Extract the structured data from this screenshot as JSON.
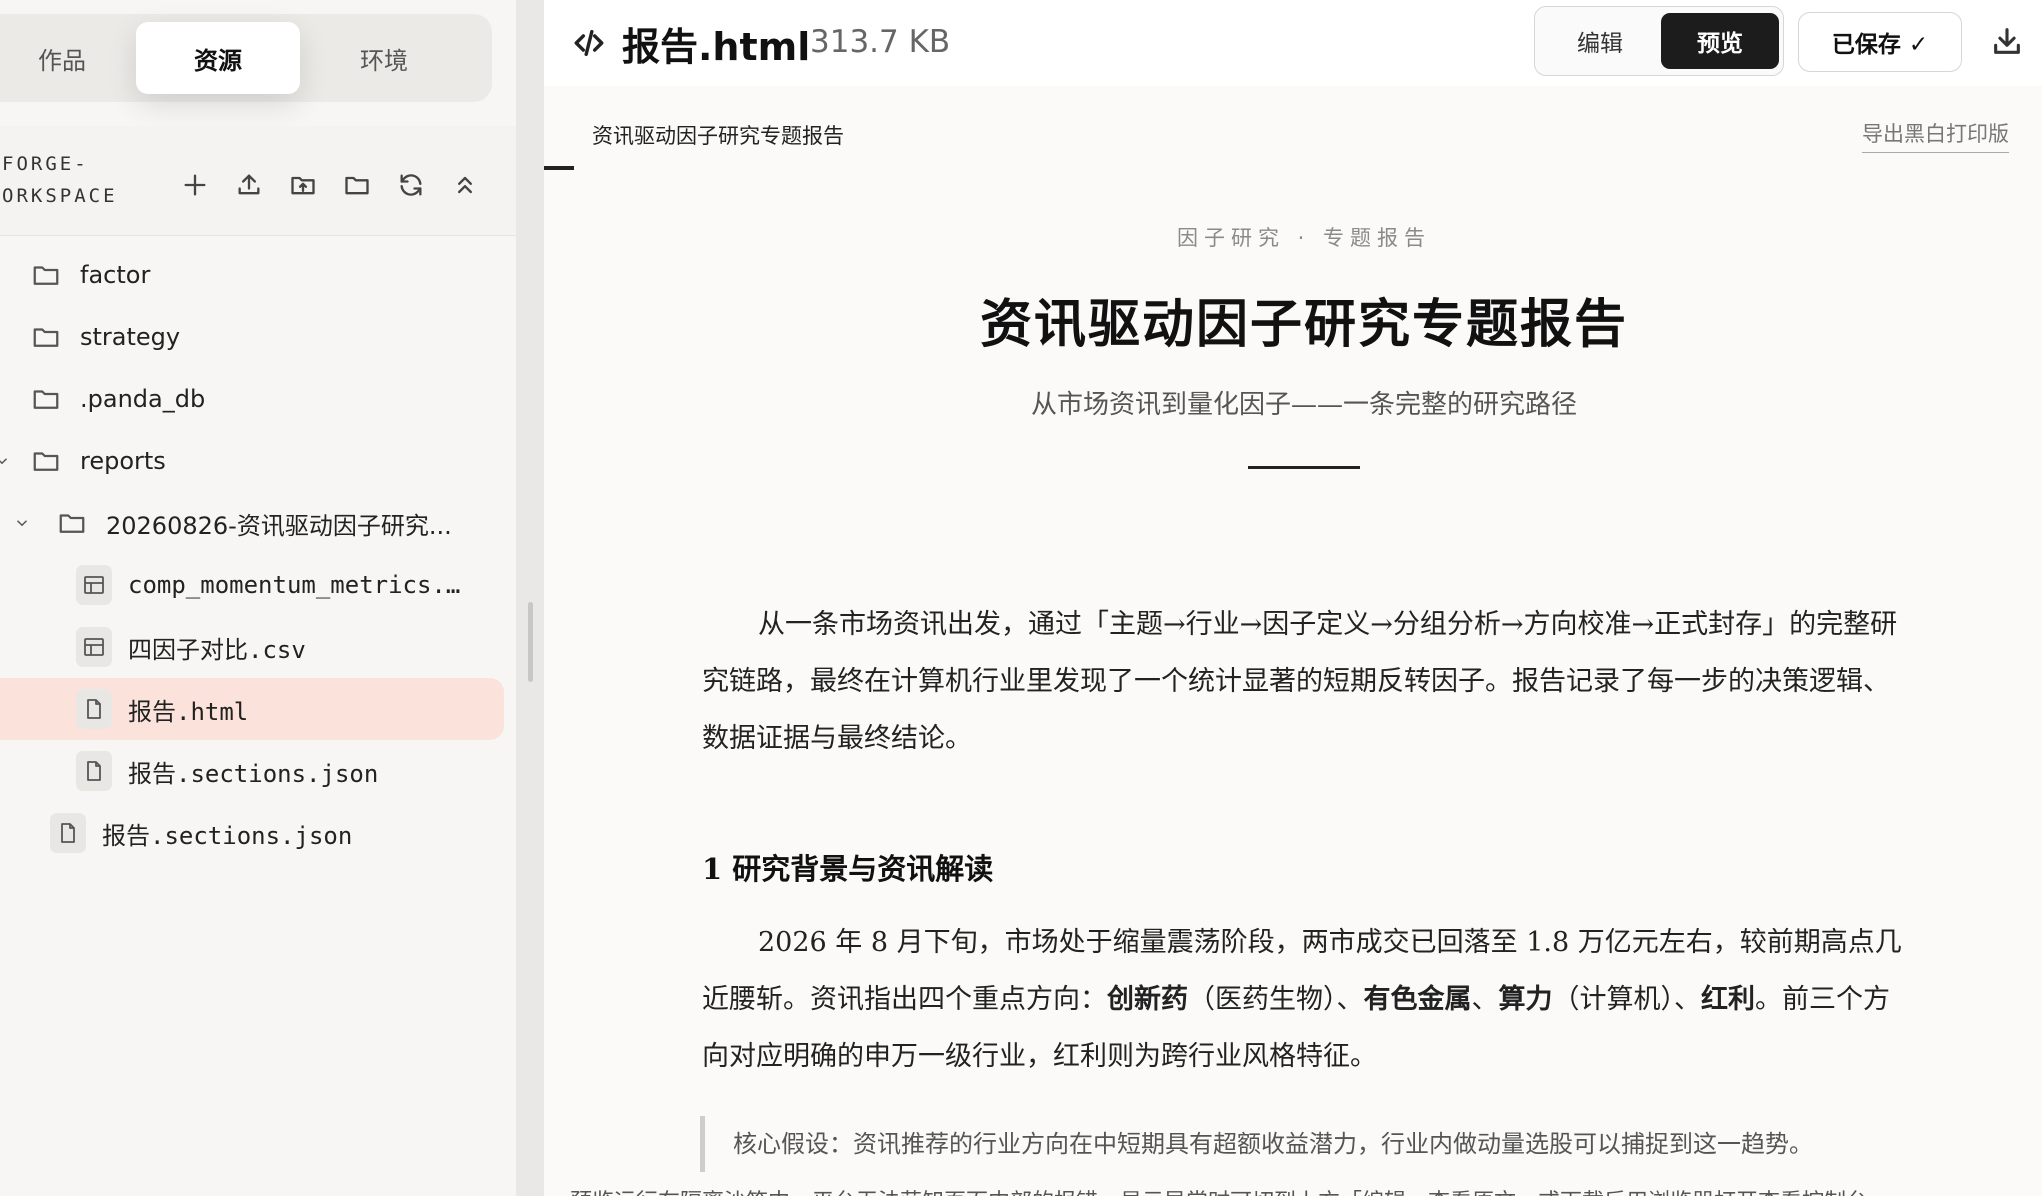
{
  "sidebar": {
    "tabs": [
      {
        "label": "作品"
      },
      {
        "label": "资源"
      },
      {
        "label": "环境"
      }
    ],
    "workspace_name": "FORGE-\nORKSPACE",
    "tools": [
      "plus-icon",
      "upload-icon",
      "folder-upload-icon",
      "folder-icon",
      "refresh-icon",
      "collapse-icon"
    ],
    "tree": [
      {
        "label": "factor",
        "type": "folder"
      },
      {
        "label": "strategy",
        "type": "folder"
      },
      {
        "label": ".panda_db",
        "type": "folder"
      },
      {
        "label": "reports",
        "type": "folder"
      },
      {
        "label": "20260826-资讯驱动因子研究...",
        "type": "folder"
      },
      {
        "label": "comp_momentum_metrics.…",
        "type": "table"
      },
      {
        "label": "四因子对比.csv",
        "type": "table"
      },
      {
        "label": "报告.html",
        "type": "file"
      },
      {
        "label": "报告.sections.json",
        "type": "file"
      },
      {
        "label": "报告.sections.json",
        "type": "file"
      }
    ]
  },
  "topbar": {
    "file_name": "报告.html",
    "file_size": "313.7 KB",
    "edit_label": "编辑",
    "preview_label": "预览",
    "saved_label": "已保存 ✓"
  },
  "preview": {
    "tab_label": "资讯驱动因子研究专题报告",
    "export_label": "导出黑白打印版"
  },
  "doc": {
    "kicker": "因子研究 · 专题报告",
    "title": "资讯驱动因子研究专题报告",
    "subtitle": "从市场资讯到量化因子——一条完整的研究路径",
    "intro": "从一条市场资讯出发，通过「主题→行业→因子定义→分组分析→方向校准→正式封存」的完整研究链路，最终在计算机行业里发现了一个统计显著的短期反转因子。报告记录了每一步的决策逻辑、数据证据与最终结论。",
    "section1_heading": "1  研究背景与资讯解读",
    "section1_p_a": "2026 年 8 月下旬，市场处于缩量震荡阶段，两市成交已回落至 1.8 万亿元左右，较前期高点几近腰斩。资讯指出四个重点方向：",
    "section1_p_b": "创新药",
    "section1_p_c": "（医药生物）、",
    "section1_p_d": "有色金属",
    "section1_p_e": "、",
    "section1_p_f": "算力",
    "section1_p_g": "（计算机）、",
    "section1_p_h": "红利",
    "section1_p_i": "。前三个方向对应明确的申万一级行业，红利则为跨行业风格特征。",
    "quote": "核心假设：资讯推荐的行业方向在中短期具有超额收益潜力，行业内做动量选股可以捕捉到这一趋势。",
    "notice": "预览运行在隔离沙箱中，平台无法获知页面内部的报错。显示异常时可切到上方「编辑」查看原文，或下载后用浏览器打开查看控制台。"
  }
}
